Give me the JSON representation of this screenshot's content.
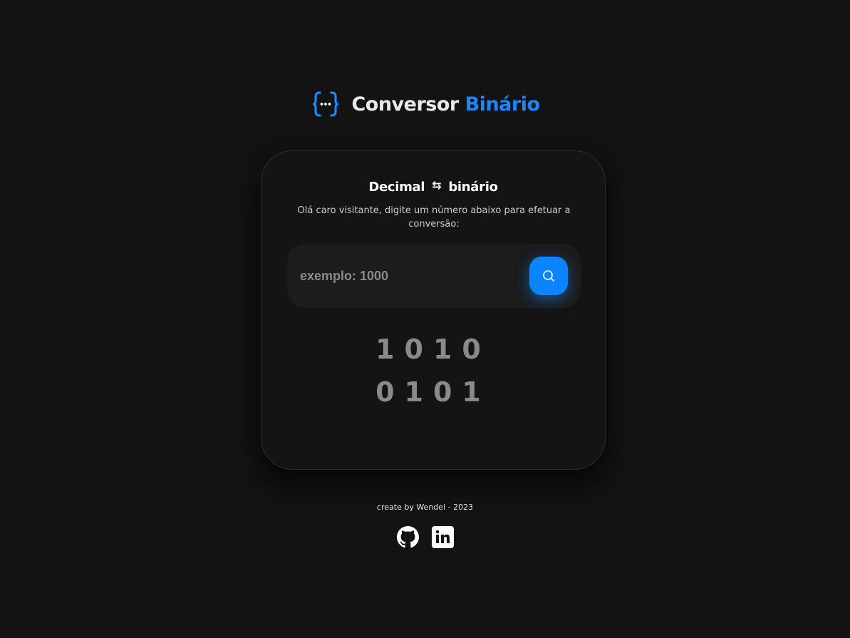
{
  "header": {
    "title_main": "Conversor",
    "title_accent": "Binário",
    "logo_icon": "code-braces-icon"
  },
  "card": {
    "title_left": "Decimal",
    "title_arrows": "⇆",
    "title_right": "binário",
    "description": "Olá caro visitante, digite um número abaixo para efetuar a conversão:",
    "search": {
      "placeholder": "exemplo: 1000",
      "value": "",
      "button_icon": "search-icon"
    },
    "result": {
      "row1": "1010",
      "row2": "0101"
    }
  },
  "footer": {
    "credit": "create by Wendel - 2023",
    "links": [
      {
        "icon": "github-icon"
      },
      {
        "icon": "linkedin-icon"
      }
    ]
  },
  "colors": {
    "background": "#131313",
    "accent": "#1b87ff",
    "button": "#0a84ff",
    "binary_text": "#8a8a8a"
  }
}
